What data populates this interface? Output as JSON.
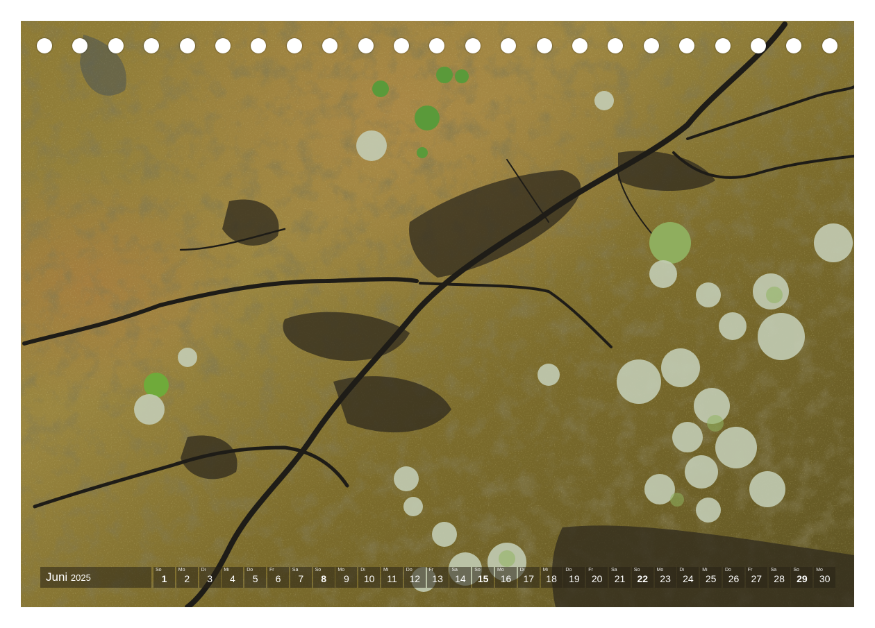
{
  "calendar": {
    "month": "Juni",
    "year": "2025",
    "days": [
      {
        "wd": "So",
        "num": "1",
        "weekend": true
      },
      {
        "wd": "Mo",
        "num": "2",
        "weekend": false
      },
      {
        "wd": "Di",
        "num": "3",
        "weekend": false
      },
      {
        "wd": "Mi",
        "num": "4",
        "weekend": false
      },
      {
        "wd": "Do",
        "num": "5",
        "weekend": false
      },
      {
        "wd": "Fr",
        "num": "6",
        "weekend": false
      },
      {
        "wd": "Sa",
        "num": "7",
        "weekend": false
      },
      {
        "wd": "So",
        "num": "8",
        "weekend": true
      },
      {
        "wd": "Mo",
        "num": "9",
        "weekend": false
      },
      {
        "wd": "Di",
        "num": "10",
        "weekend": false
      },
      {
        "wd": "Mi",
        "num": "11",
        "weekend": false
      },
      {
        "wd": "Do",
        "num": "12",
        "weekend": false
      },
      {
        "wd": "Fr",
        "num": "13",
        "weekend": false
      },
      {
        "wd": "Sa",
        "num": "14",
        "weekend": false
      },
      {
        "wd": "So",
        "num": "15",
        "weekend": true
      },
      {
        "wd": "Mo",
        "num": "16",
        "weekend": false
      },
      {
        "wd": "Di",
        "num": "17",
        "weekend": false
      },
      {
        "wd": "Mi",
        "num": "18",
        "weekend": false
      },
      {
        "wd": "Do",
        "num": "19",
        "weekend": false
      },
      {
        "wd": "Fr",
        "num": "20",
        "weekend": false
      },
      {
        "wd": "Sa",
        "num": "21",
        "weekend": false
      },
      {
        "wd": "So",
        "num": "22",
        "weekend": true
      },
      {
        "wd": "Mo",
        "num": "23",
        "weekend": false
      },
      {
        "wd": "Di",
        "num": "24",
        "weekend": false
      },
      {
        "wd": "Mi",
        "num": "25",
        "weekend": false
      },
      {
        "wd": "Do",
        "num": "26",
        "weekend": false
      },
      {
        "wd": "Fr",
        "num": "27",
        "weekend": false
      },
      {
        "wd": "Sa",
        "num": "28",
        "weekend": false
      },
      {
        "wd": "So",
        "num": "29",
        "weekend": true
      },
      {
        "wd": "Mo",
        "num": "30",
        "weekend": false
      }
    ]
  },
  "binding": {
    "hole_count": 23
  },
  "colors": {
    "grass": "#8a7a34",
    "water": "#2c2a22",
    "tree": "#b9c7a0",
    "background": "#ffffff"
  }
}
